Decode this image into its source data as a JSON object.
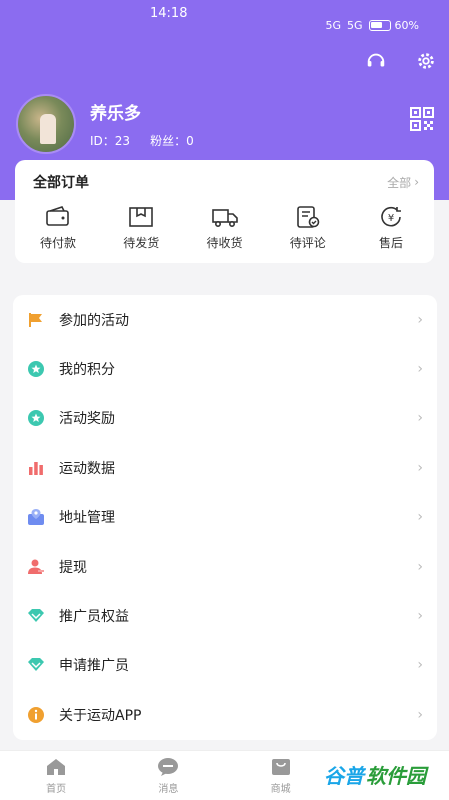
{
  "status_bar": {
    "time": "14:18",
    "battery_text": "60%",
    "network_a": "5G",
    "network_b": "5G"
  },
  "profile": {
    "name": "养乐多",
    "id_label": "ID：",
    "id_value": "23",
    "fans_label": "粉丝：",
    "fans_value": "0"
  },
  "orders": {
    "title": "全部订单",
    "all_label": "全部",
    "items": [
      {
        "label": "待付款",
        "icon": "wallet-icon"
      },
      {
        "label": "待发货",
        "icon": "package-icon"
      },
      {
        "label": "待收货",
        "icon": "truck-icon"
      },
      {
        "label": "待评论",
        "icon": "review-icon"
      },
      {
        "label": "售后",
        "icon": "refund-icon"
      }
    ]
  },
  "menu": {
    "items": [
      {
        "label": "参加的活动",
        "icon": "flag-icon",
        "color": "#f0a030"
      },
      {
        "label": "我的积分",
        "icon": "points-icon",
        "color": "#3cc8b0"
      },
      {
        "label": "活动奖励",
        "icon": "reward-icon",
        "color": "#3cc8b0"
      },
      {
        "label": "运动数据",
        "icon": "bar-chart-icon",
        "color": "#f06c6c"
      },
      {
        "label": "地址管理",
        "icon": "address-icon",
        "color": "#6f8cf0"
      },
      {
        "label": "提现",
        "icon": "withdraw-icon",
        "color": "#f06c6c"
      },
      {
        "label": "推广员权益",
        "icon": "promoter-rights-icon",
        "color": "#3cc8b0"
      },
      {
        "label": "申请推广员",
        "icon": "apply-promoter-icon",
        "color": "#3cc8b0"
      },
      {
        "label": "关于运动APP",
        "icon": "info-icon",
        "color": "#f0a030"
      }
    ]
  },
  "bottom_nav": {
    "items": [
      {
        "label": "首页",
        "icon": "home-icon"
      },
      {
        "label": "消息",
        "icon": "message-icon"
      },
      {
        "label": "商城",
        "icon": "shop-icon"
      },
      {
        "label": "我的",
        "icon": "profile-icon"
      }
    ]
  },
  "watermark": {
    "part_a": "谷普",
    "part_b": "软件园"
  },
  "colors": {
    "header_purple": "#8b6cf0"
  }
}
